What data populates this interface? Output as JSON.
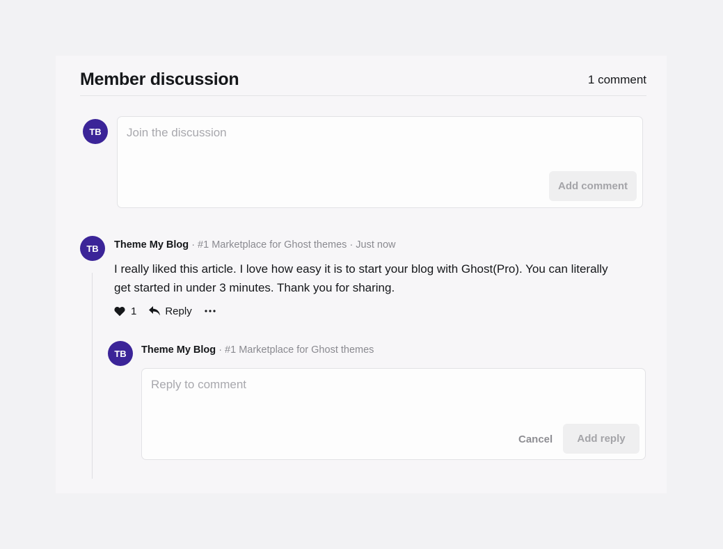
{
  "discussion": {
    "title": "Member discussion",
    "count_label": "1 comment"
  },
  "composer": {
    "avatar_initials": "TB",
    "placeholder": "Join the discussion",
    "submit_label": "Add comment"
  },
  "comment": {
    "avatar_initials": "TB",
    "author": "Theme My Blog",
    "meta": "· #1 Marketplace for Ghost themes · Just now",
    "body": "I really liked this article. I love how easy it is to start your blog with Ghost(Pro). You can literally get started in under 3 minutes. Thank you for sharing.",
    "like_count": "1",
    "reply_label": "Reply",
    "more_icon": "ellipsis-icon",
    "like_icon": "heart-icon",
    "reply_icon": "reply-arrow-icon"
  },
  "reply_form": {
    "avatar_initials": "TB",
    "author": "Theme My Blog",
    "meta": "· #1 Marketplace for Ghost themes",
    "placeholder": "Reply to comment",
    "cancel_label": "Cancel",
    "submit_label": "Add reply"
  },
  "colors": {
    "avatar": "#3b2498",
    "page_background": "#f2f2f4",
    "panel_background": "#f7f6f8"
  }
}
